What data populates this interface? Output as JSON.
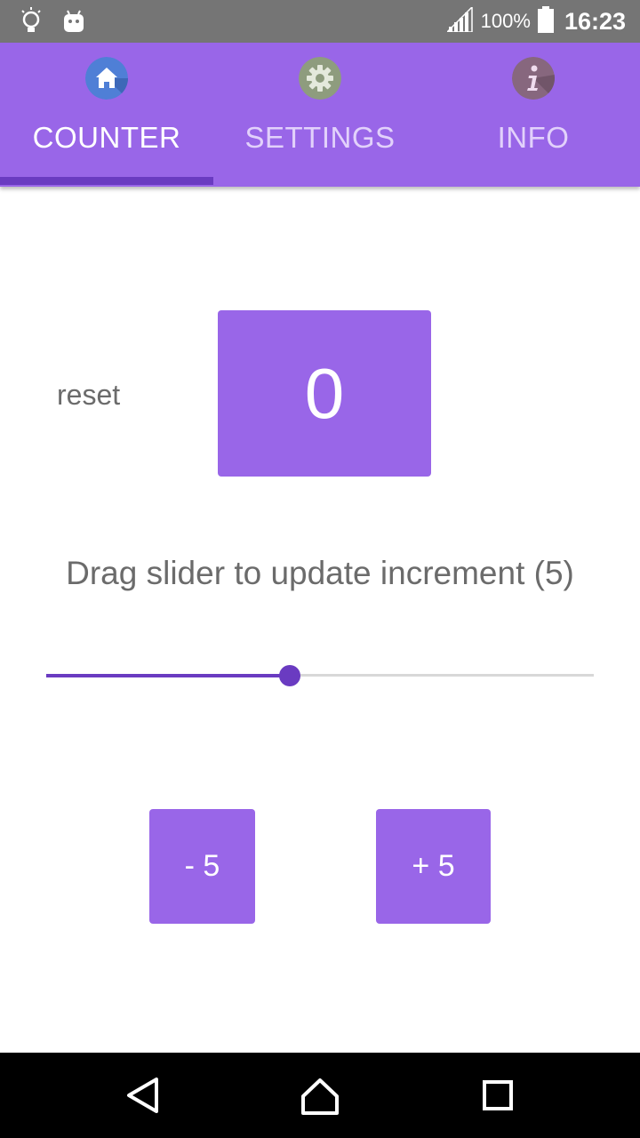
{
  "status_bar": {
    "left_icons": [
      "lightbulb-icon",
      "android-icon"
    ],
    "signal_icon": "signal-icon",
    "battery_text": "100%",
    "battery_icon": "battery-icon",
    "time": "16:23"
  },
  "tabs": [
    {
      "label": "COUNTER",
      "icon": "home-icon",
      "active": true
    },
    {
      "label": "SETTINGS",
      "icon": "gear-icon",
      "active": false
    },
    {
      "label": "INFO",
      "icon": "info-icon",
      "active": false
    }
  ],
  "counter": {
    "reset_label": "reset",
    "value": "0"
  },
  "slider": {
    "caption": "Drag slider to update increment (5)",
    "value_fraction": 0.445
  },
  "buttons": {
    "minus_label": "- 5",
    "plus_label": "+ 5"
  },
  "nav_bar": {
    "icons": [
      "back-icon",
      "home-nav-icon",
      "recents-icon"
    ]
  },
  "colors": {
    "primary": "#9966e8",
    "accent": "#6a3bc1",
    "status_bar": "#757575",
    "text_gray": "#6b6b6b"
  }
}
